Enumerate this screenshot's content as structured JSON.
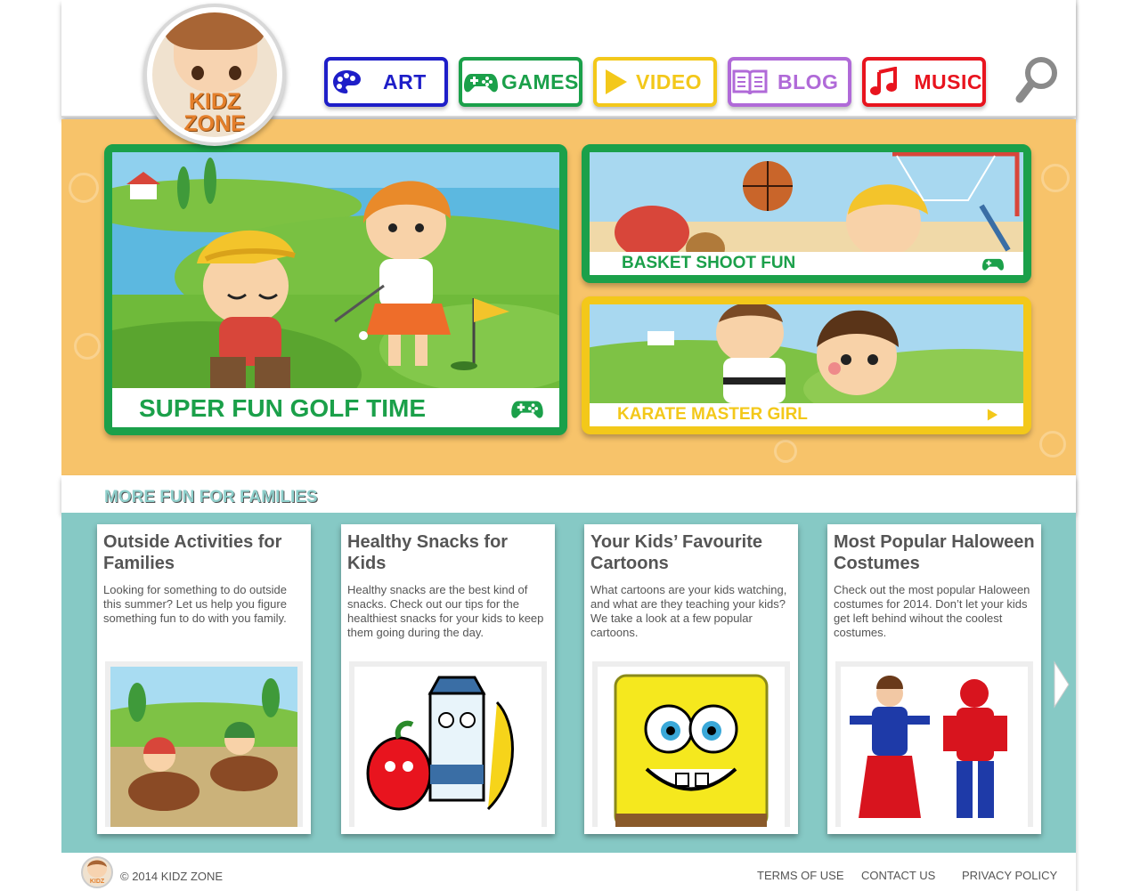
{
  "logo": {
    "line1": "KIDZ",
    "line2": "ZONE"
  },
  "nav": [
    {
      "label": "ART",
      "icon": "palette-icon",
      "color": "#1e1ec8"
    },
    {
      "label": "GAMES",
      "icon": "gamepad-icon",
      "color": "#1ba04a"
    },
    {
      "label": "VIDEO",
      "icon": "play-icon",
      "color": "#f3c81a"
    },
    {
      "label": "BLOG",
      "icon": "book-icon",
      "color": "#b06ad8"
    },
    {
      "label": "MUSIC",
      "icon": "music-note-icon",
      "color": "#e8141e"
    }
  ],
  "search": {
    "icon": "search-icon"
  },
  "featured": {
    "main": {
      "title": "SUPER FUN GOLF TIME",
      "icon": "gamepad-icon",
      "color": "#1ba04a"
    },
    "top_right": {
      "title": "BASKET SHOOT FUN",
      "icon": "gamepad-icon",
      "color": "#1ba04a"
    },
    "bottom_right": {
      "title": "KARATE MASTER GIRL",
      "icon": "play-icon",
      "color": "#f3c81a"
    }
  },
  "more": {
    "title": "MORE FUN FOR FAMILIES"
  },
  "articles": [
    {
      "title": "Outside Activities for Families",
      "text": "Looking for something to do outside this summer? Let us help you figure something fun to do with you family."
    },
    {
      "title": "Healthy Snacks for Kids",
      "text": "Healthy snacks are the best kind of snacks. Check out our tips for the healthiest snacks for your kids to keep them going during the day."
    },
    {
      "title": "Your Kids’ Favourite Cartoons",
      "text": "What cartoons are your kids watching, and what are they teaching your kids? We take a look at a few popular cartoons."
    },
    {
      "title": "Most Popular Haloween Costumes",
      "text": "Check out the most popular Haloween costumes for 2014. Don’t let your kids get left behind wihout the coolest costumes."
    }
  ],
  "footer": {
    "copyright": "© 2014 KIDZ ZONE",
    "links": [
      "TERMS OF USE",
      "CONTACT US",
      "PRIVACY POLICY"
    ]
  }
}
